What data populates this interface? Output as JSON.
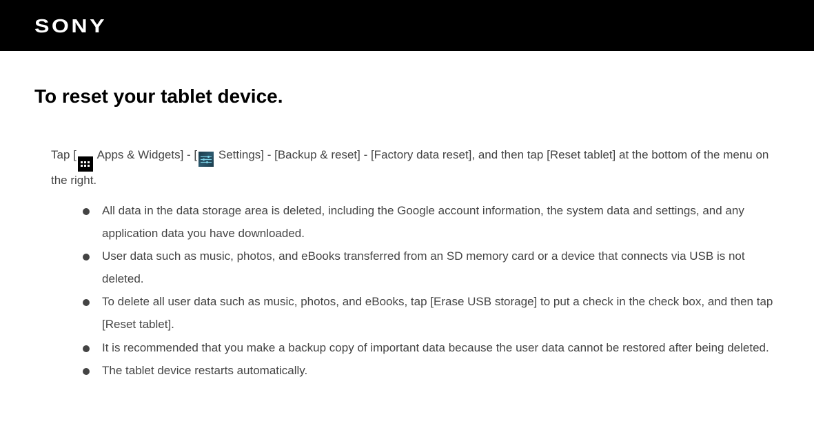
{
  "header": {
    "brand": "SONY"
  },
  "title": "To reset your tablet device.",
  "intro": {
    "part1": "Tap [",
    "part2": " Apps & Widgets] - [",
    "part3": " Settings] - [Backup & reset] - [Factory data reset], and then tap [Reset tablet] at the bottom of the menu on the right."
  },
  "bullets": [
    "All data in the data storage area is deleted, including the Google account information, the system data and settings, and any application data you have downloaded.",
    "User data such as music, photos, and eBooks transferred from an SD memory card or a device that connects via USB is not deleted.",
    "To delete all user data such as music, photos, and eBooks, tap [Erase USB storage] to put a check in the check box, and then tap [Reset tablet].",
    "It is recommended that you make a backup copy of important data because the user data cannot be restored after being deleted.",
    "The tablet device restarts automatically."
  ]
}
